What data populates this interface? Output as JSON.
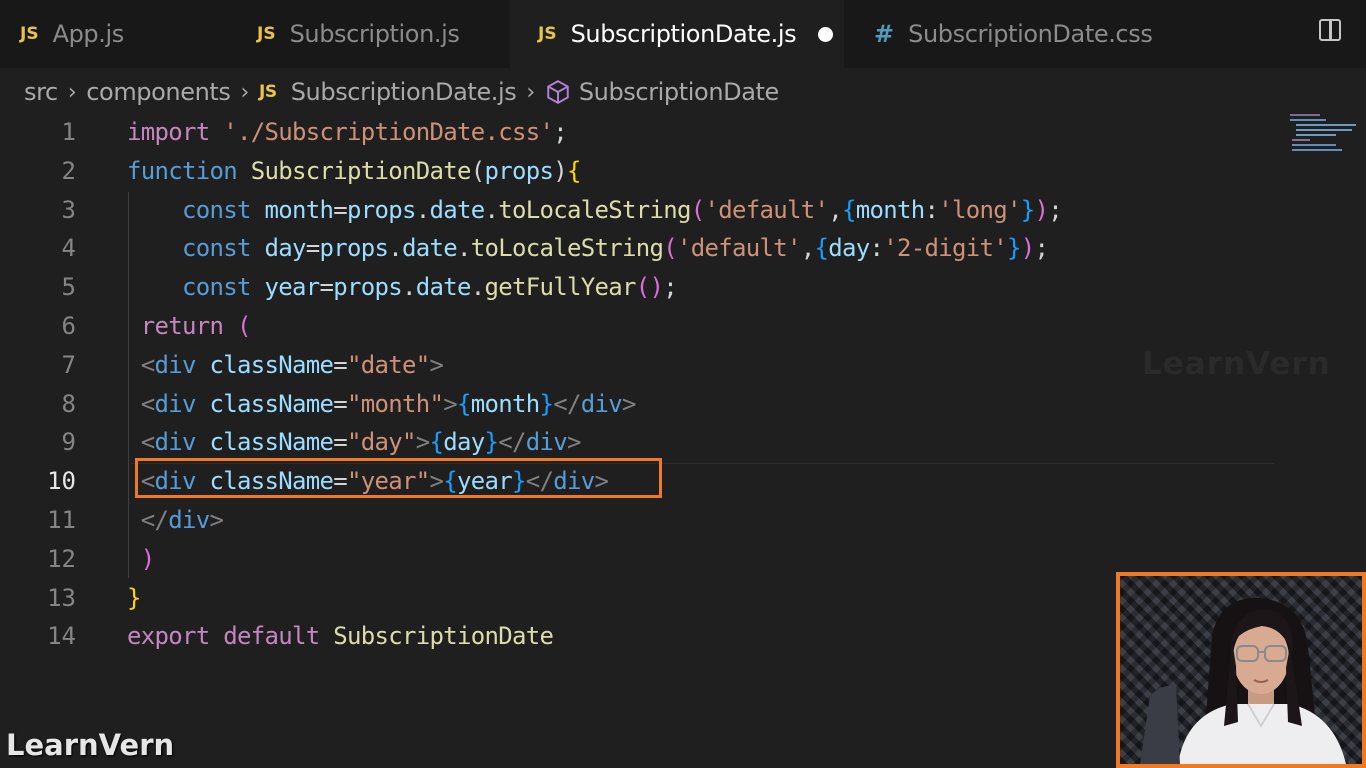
{
  "tabs": [
    {
      "icon": "JS",
      "label": "App.js",
      "active": false
    },
    {
      "icon": "JS",
      "label": "Subscription.js",
      "active": false
    },
    {
      "icon": "JS",
      "label": "SubscriptionDate.js",
      "active": true,
      "unsaved": true
    },
    {
      "icon": "#",
      "label": "SubscriptionDate.css",
      "active": false
    }
  ],
  "breadcrumb": {
    "parts": [
      "src",
      "components"
    ],
    "file_icon": "JS",
    "file": "SubscriptionDate.js",
    "symbol": "SubscriptionDate"
  },
  "editor": {
    "current_line": 10,
    "line_numbers": [
      "1",
      "2",
      "3",
      "4",
      "5",
      "6",
      "7",
      "8",
      "9",
      "10",
      "11",
      "12",
      "13",
      "14"
    ],
    "lines": [
      "import './SubscriptionDate.css';",
      "function SubscriptionDate(props){",
      "    const month=props.date.toLocaleString('default',{month:'long'});",
      "    const day=props.date.toLocaleString('default',{day:'2-digit'});",
      "    const year=props.date.getFullYear();",
      " return (",
      " <div className=\"date\">",
      " <div className=\"month\">{month}</div>",
      " <div className=\"day\">{day}</div>",
      " <div className=\"year\">{year}</div>",
      " </div>",
      " )",
      "}",
      "export default SubscriptionDate"
    ]
  },
  "watermark": "LearnVern",
  "colors": {
    "highlight": "#f07a24",
    "js_icon": "#e8c547",
    "css_icon": "#519aba"
  }
}
